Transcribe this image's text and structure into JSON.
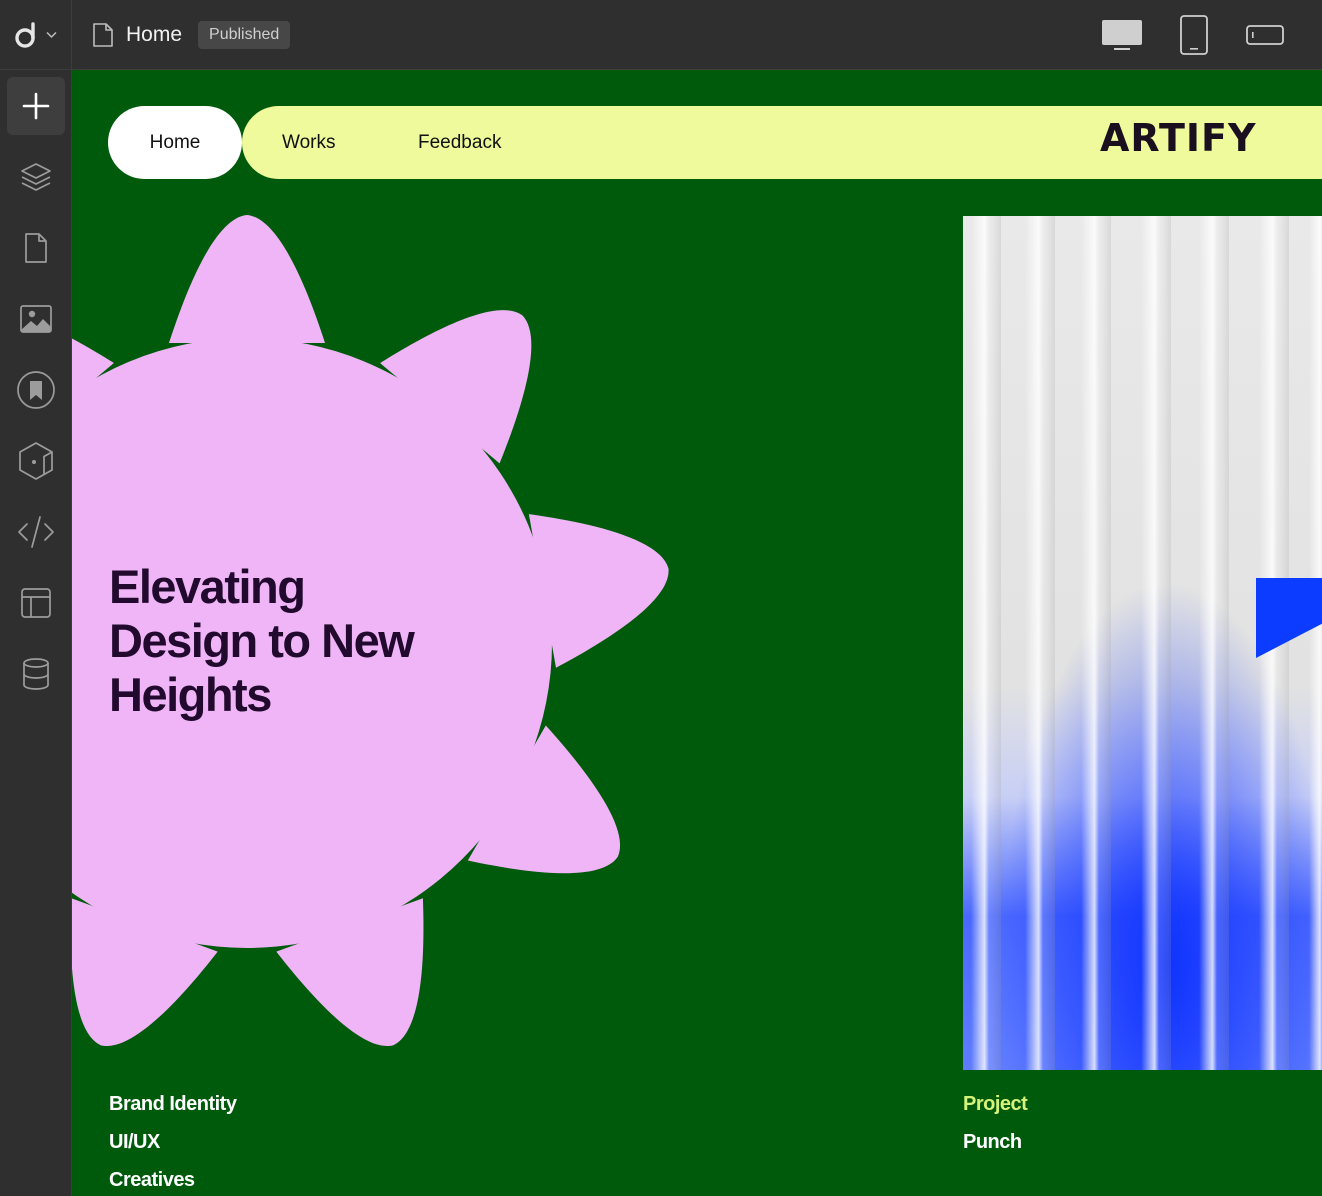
{
  "app": {
    "logo_icon": "d-logo-icon",
    "page_title": "Home",
    "status": "Published"
  },
  "devices": [
    "desktop-icon",
    "tablet-icon",
    "mobile-landscape-icon"
  ],
  "tools": [
    "add-icon",
    "layers-icon",
    "pages-icon",
    "media-icon",
    "bookmark-icon",
    "components-icon",
    "code-icon",
    "layout-icon",
    "database-icon"
  ],
  "site": {
    "nav": {
      "home": "Home",
      "works": "Works",
      "feedback": "Feedback",
      "brand": "ARTIFY"
    },
    "hero": {
      "line1": "Elevating",
      "line2": "Design to New",
      "line3": "Heights"
    },
    "services": [
      "Brand Identity",
      "UI/UX",
      "Creatives"
    ],
    "project": {
      "label": "Project",
      "name": "Punch"
    }
  },
  "colors": {
    "canvas_bg": "#005a0b",
    "nav_bg": "#eefa9c",
    "flower": "#f0b5f7",
    "heading": "#220a2e",
    "accent_blue": "#0b3cff",
    "project_label": "#d6f27a"
  }
}
